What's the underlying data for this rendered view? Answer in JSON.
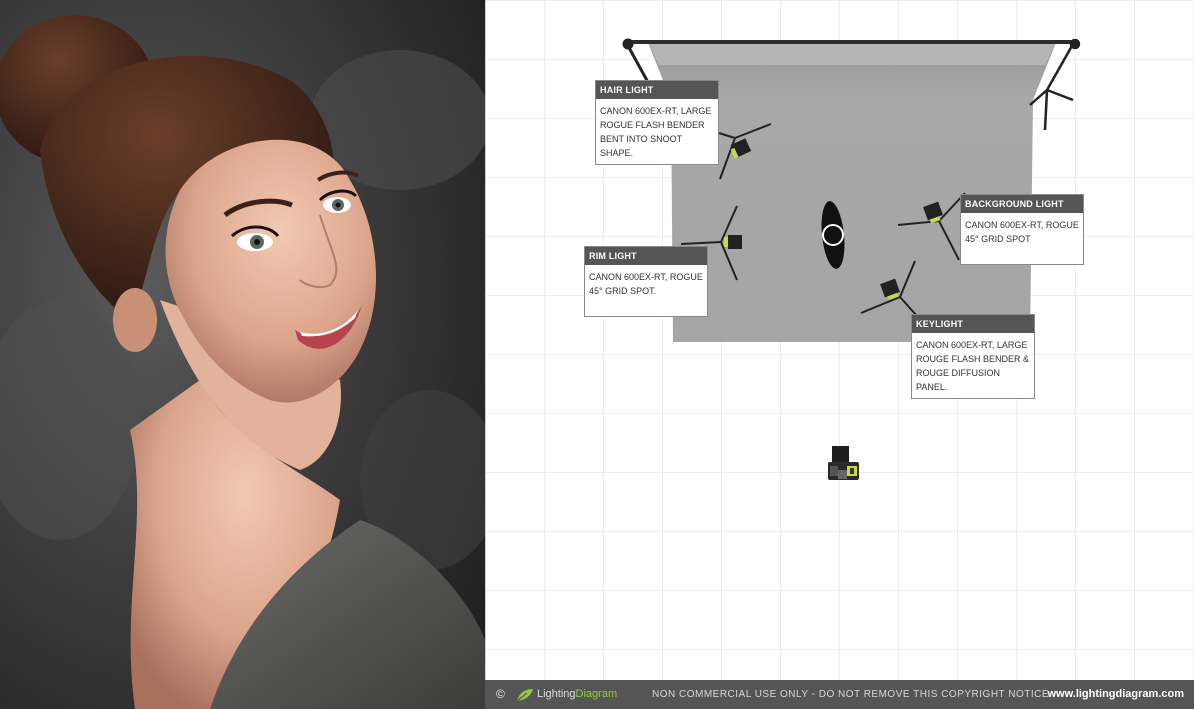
{
  "labels": {
    "hair": {
      "title": "HAIR LIGHT",
      "desc": "CANON 600EX-RT, LARGE ROGUE FLASH BENDER BENT INTO SNOOT SHAPE."
    },
    "rim": {
      "title": "RIM LIGHT",
      "desc": "CANON 600EX-RT, ROGUE 45° GRID SPOT."
    },
    "background": {
      "title": "BACKGROUND LIGHT",
      "desc": "CANON 600EX-RT, ROGUE 45° GRID SPOT"
    },
    "key": {
      "title": "KEYLIGHT",
      "desc": "CANON 600EX-RT, LARGE ROUGE FLASH BENDER & ROUGE DIFFUSION PANEL."
    }
  },
  "footer": {
    "copyright_symbol": "©",
    "brand_lighting": "Lighting",
    "brand_diagram": "Diagram",
    "notice": "NON COMMERCIAL USE ONLY - DO NOT REMOVE THIS COPYRIGHT NOTICE",
    "url": "www.lightingdiagram.com"
  },
  "colors": {
    "grid_line": "#dcdcdc",
    "backdrop": "#a6a6a6",
    "label_header": "#555555",
    "footer_bg": "#555555",
    "brand_green": "#8fcf3f",
    "photo_bg": "#2e2e2e"
  }
}
